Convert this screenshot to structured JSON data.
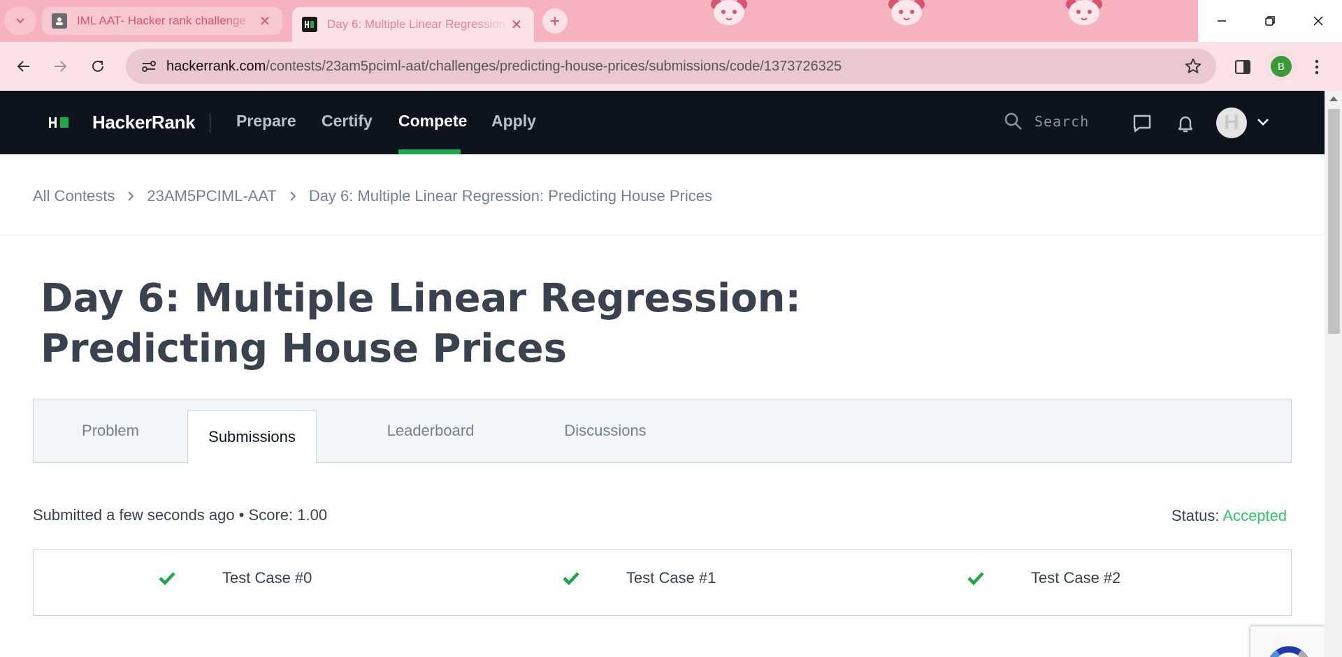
{
  "browser": {
    "tabs": [
      {
        "title": "IML AAT- Hacker rank challenge",
        "active": false
      },
      {
        "title": "Day 6: Multiple Linear Regression",
        "active": true
      }
    ],
    "url_host": "hackerrank.com",
    "url_path": "/contests/23am5pciml-aat/challenges/predicting-house-prices/submissions/code/1373726325",
    "profile_initial": "B",
    "theme_color": "#f6b2be"
  },
  "site": {
    "brand": "HackerRank",
    "nav": [
      "Prepare",
      "Certify",
      "Compete",
      "Apply"
    ],
    "active_nav": "Compete",
    "search_placeholder": "Search",
    "avatar_initial": "H",
    "accent": "#1ba94c"
  },
  "breadcrumb": [
    "All Contests",
    "23AM5PCIML-AAT",
    "Day 6: Multiple Linear Regression: Predicting House Prices"
  ],
  "challenge": {
    "title_line1": "Day 6: Multiple Linear Regression:",
    "title_line2": "Predicting House Prices",
    "tabs": [
      "Problem",
      "Submissions",
      "Leaderboard",
      "Discussions"
    ],
    "active_tab": "Submissions"
  },
  "submission": {
    "summary": "Submitted a few seconds ago • Score: 1.00",
    "status_label": "Status:",
    "status_value": "Accepted",
    "status_color": "#2ec866",
    "test_cases": [
      "Test Case #0",
      "Test Case #1",
      "Test Case #2"
    ]
  }
}
